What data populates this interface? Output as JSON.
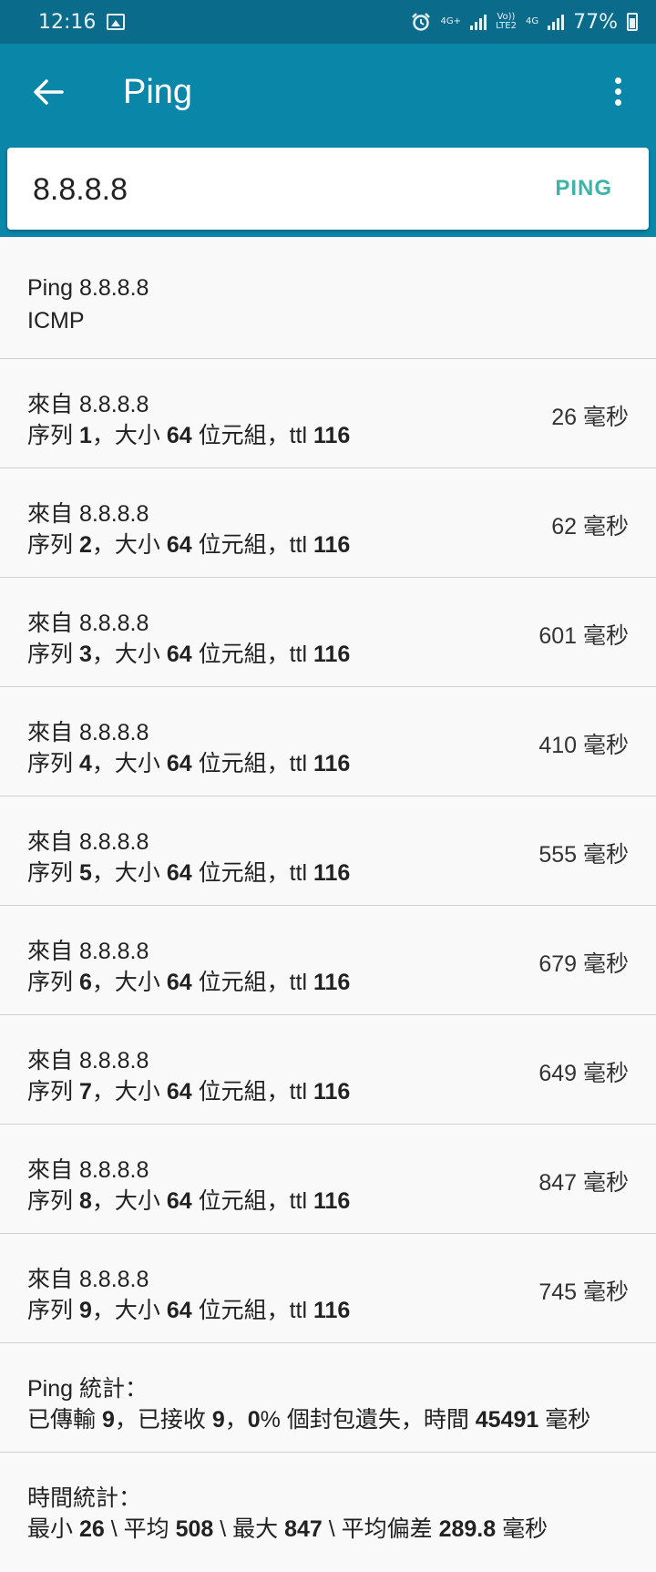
{
  "status_bar": {
    "time": "12:16",
    "net1": "4G+",
    "net2_top": "Vo))",
    "net2_bottom": "LTE2",
    "net3": "4G",
    "battery": "77%"
  },
  "app_bar": {
    "title": "Ping"
  },
  "search": {
    "host_value": "8.8.8.8",
    "ping_label": "PING"
  },
  "header_row": {
    "title": "Ping 8.8.8.8",
    "protocol": "ICMP"
  },
  "results": [
    {
      "from": "來自 8.8.8.8",
      "seq_prefix": "序列 ",
      "seq": "1",
      "size_prefix": "，大小 ",
      "size": "64",
      "unit_ttl": " 位元組，ttl ",
      "ttl": "116",
      "time": "26 毫秒"
    },
    {
      "from": "來自 8.8.8.8",
      "seq_prefix": "序列 ",
      "seq": "2",
      "size_prefix": "，大小 ",
      "size": "64",
      "unit_ttl": " 位元組，ttl ",
      "ttl": "116",
      "time": "62 毫秒"
    },
    {
      "from": "來自 8.8.8.8",
      "seq_prefix": "序列 ",
      "seq": "3",
      "size_prefix": "，大小 ",
      "size": "64",
      "unit_ttl": " 位元組，ttl ",
      "ttl": "116",
      "time": "601 毫秒"
    },
    {
      "from": "來自 8.8.8.8",
      "seq_prefix": "序列 ",
      "seq": "4",
      "size_prefix": "，大小 ",
      "size": "64",
      "unit_ttl": " 位元組，ttl ",
      "ttl": "116",
      "time": "410 毫秒"
    },
    {
      "from": "來自 8.8.8.8",
      "seq_prefix": "序列 ",
      "seq": "5",
      "size_prefix": "，大小 ",
      "size": "64",
      "unit_ttl": " 位元組，ttl ",
      "ttl": "116",
      "time": "555 毫秒"
    },
    {
      "from": "來自 8.8.8.8",
      "seq_prefix": "序列 ",
      "seq": "6",
      "size_prefix": "，大小 ",
      "size": "64",
      "unit_ttl": " 位元組，ttl ",
      "ttl": "116",
      "time": "679 毫秒"
    },
    {
      "from": "來自 8.8.8.8",
      "seq_prefix": "序列 ",
      "seq": "7",
      "size_prefix": "，大小 ",
      "size": "64",
      "unit_ttl": " 位元組，ttl ",
      "ttl": "116",
      "time": "649 毫秒"
    },
    {
      "from": "來自 8.8.8.8",
      "seq_prefix": "序列 ",
      "seq": "8",
      "size_prefix": "，大小 ",
      "size": "64",
      "unit_ttl": " 位元組，ttl ",
      "ttl": "116",
      "time": "847 毫秒"
    },
    {
      "from": "來自 8.8.8.8",
      "seq_prefix": "序列 ",
      "seq": "9",
      "size_prefix": "，大小 ",
      "size": "64",
      "unit_ttl": " 位元組，ttl ",
      "ttl": "116",
      "time": "745 毫秒"
    }
  ],
  "ping_stats": {
    "label_bold": "Ping",
    "label_rest": " 統計：",
    "p1": "已傳輸 ",
    "sent": "9",
    "p2": "，已接收 ",
    "received": "9",
    "p3": "，",
    "loss": "0",
    "p4": "% 個封包遺失，時間 ",
    "total_time": "45491",
    "p5": " 毫秒"
  },
  "time_stats": {
    "label": "時間統計：",
    "p1": "最小 ",
    "min": "26",
    "p2": " \\ 平均 ",
    "avg": "508",
    "p3": " \\ 最大 ",
    "max": "847",
    "p4": " \\ 平均偏差 ",
    "mdev": "289.8",
    "p5": " 毫秒"
  }
}
